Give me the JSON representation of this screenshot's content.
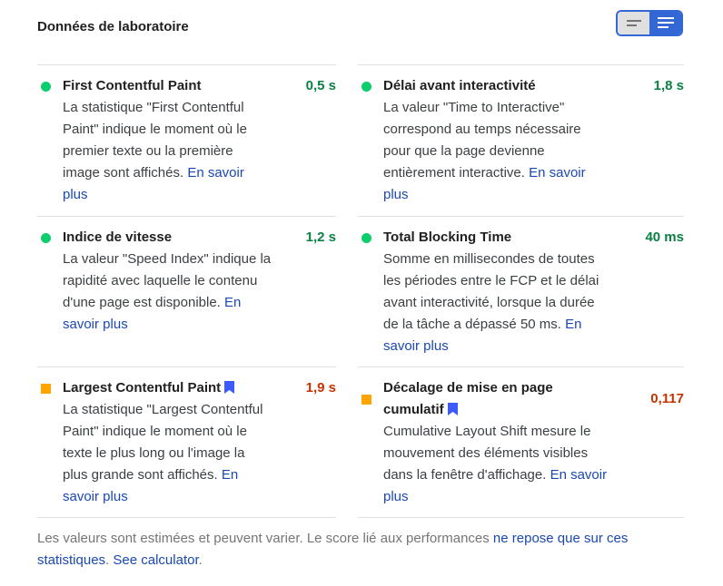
{
  "header": {
    "title": "Données de laboratoire"
  },
  "toggle": {
    "left_icon": "compact-list-icon",
    "right_icon": "expanded-list-icon"
  },
  "metrics": [
    {
      "title": "First Contentful Paint",
      "value": "0,5 s",
      "status": "pass",
      "desc": "La statistique \"First Contentful Paint\" indique le moment où le premier texte ou la première image sont affichés.",
      "link": "En savoir plus"
    },
    {
      "title": "Délai avant interactivité",
      "value": "1,8 s",
      "status": "pass",
      "desc": "La valeur \"Time to Interactive\" correspond au temps nécessaire pour que la page devienne entièrement interactive.",
      "link": "En savoir plus"
    },
    {
      "title": "Indice de vitesse",
      "value": "1,2 s",
      "status": "pass",
      "desc": "La valeur \"Speed Index\" indique la rapidité avec laquelle le contenu d'une page est disponible.",
      "link": "En savoir plus"
    },
    {
      "title": "Total Blocking Time",
      "value": "40 ms",
      "status": "pass",
      "desc": "Somme en millisecondes de toutes les périodes entre le FCP et le délai avant interactivité, lorsque la durée de la tâche a dépassé 50 ms.",
      "link": "En savoir plus"
    },
    {
      "title": "Largest Contentful Paint",
      "value": "1,9 s",
      "status": "average",
      "desc": "La statistique \"Largest Contentful Paint\" indique le moment où le texte le plus long ou l'image la plus grande sont affichés.",
      "link": "En savoir plus"
    },
    {
      "title": "Décalage de mise en page cumulatif",
      "value": "0,117",
      "status": "average",
      "desc": "Cumulative Layout Shift mesure le mouvement des éléments visibles dans la fenêtre d'affichage.",
      "link": "En savoir plus"
    }
  ],
  "footer": {
    "text": "Les valeurs sont estimées et peuvent varier. Le score lié aux performances ",
    "link1": "ne repose que sur ces statistiques",
    "sep": ". ",
    "link2": "See calculator",
    "end": "."
  },
  "colors": {
    "pass": "#0cce6b",
    "average": "#ffa400",
    "link": "#1a48b3",
    "accent": "#3367d6"
  }
}
